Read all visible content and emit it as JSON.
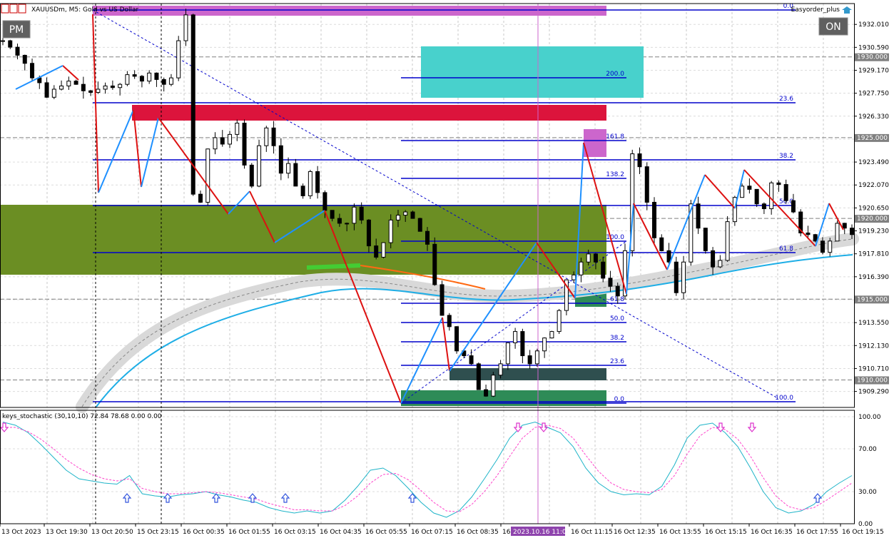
{
  "header": {
    "symbol_text": "XAUUSDm, M5:  Gold vs US Dollar",
    "ea_text": "Easyorder_plus",
    "pm_button": "PM",
    "on_button": "ON"
  },
  "price_axis": {
    "ticks": [
      "1932.010",
      "1930.590",
      "1929.170",
      "1927.750",
      "1926.330",
      "1924.910",
      "1923.490",
      "1922.070",
      "1920.650",
      "1919.230",
      "1917.810",
      "1916.390",
      "1914.970",
      "1913.550",
      "1912.130",
      "1910.710",
      "1909.290"
    ],
    "badges": [
      "1930.000",
      "1925.000",
      "1920.000",
      "1915.000",
      "1910.000"
    ]
  },
  "indicator": {
    "label": "keys_stochastic (30,10,10) 72.84 78.68 0.00 0.00",
    "ticks": [
      "100.00",
      "70.00",
      "30.00",
      "0.00"
    ]
  },
  "time_axis": {
    "labels": [
      "13 Oct 2023",
      "13 Oct 19:30",
      "13 Oct 20:50",
      "15 Oct 23:15",
      "16 Oct 00:35",
      "16 Oct 01:55",
      "16 Oct 03:15",
      "16 Oct 04:35",
      "16 Oct 05:55",
      "16 Oct 07:15",
      "16 Oct 08:35",
      "16",
      "16 Oct 11:15",
      "16 Oct 12:35",
      "16 Oct 13:55",
      "16 Oct 15:15",
      "16 Oct 16:35",
      "16 Oct 17:55",
      "16 Oct 19:15"
    ],
    "highlight": "2023.10.16 11:00"
  },
  "chart_data": [
    {
      "type": "candlestick",
      "title": "XAUUSDm, M5:  Gold vs US Dollar",
      "y_axis": "price",
      "ylim": [
        1908.3,
        1933.3
      ],
      "grid": true,
      "price_badges": [
        1930.0,
        1925.0,
        1920.0,
        1915.0,
        1910.0
      ],
      "fib_levels_left": [
        "0.0",
        "23.6",
        "38.2",
        "50.0",
        "61.8",
        "100.0"
      ],
      "fib_levels_right": [
        "200.0",
        "161.8",
        "138.2",
        "100.0",
        "-61.8",
        "50.0",
        "38.2",
        "23.6",
        "0.0"
      ],
      "zones": [
        {
          "color": "#cc66cc"
        },
        {
          "color": "#48d1cc"
        },
        {
          "color": "#dc143c"
        },
        {
          "color": "#6b8e23"
        },
        {
          "color": "#2e8b57"
        },
        {
          "color": "#2f4f4f"
        }
      ],
      "close_path": [
        1931,
        1930.6,
        1930.1,
        1929.6,
        1928.7,
        1928.4,
        1927.5,
        1928.0,
        1928.2,
        1928.5,
        1928.3,
        1927.9,
        1927.8,
        1928.0,
        1928.2,
        1928.1,
        1928.3,
        1928.9,
        1928.8,
        1928.5,
        1929.0,
        1928.6,
        1928.3,
        1928.7,
        1931.0,
        1932.6,
        1921.5,
        1921.0,
        1924.3,
        1925.0,
        1924.6,
        1925.2,
        1925.9,
        1923.3,
        1922.0,
        1924.5,
        1925.6,
        1924.5,
        1922.8,
        1923.4,
        1922.0,
        1921.4,
        1922.9,
        1921.6,
        1920.5,
        1920.0,
        1919.7,
        1919.7,
        1920.7,
        1919.9,
        1918.3,
        1917.6,
        1918.5,
        1919.9,
        1920.2,
        1920.4,
        1920.0,
        1919.2,
        1918.4,
        1915.9,
        1914.0,
        1913.3,
        1911.8,
        1911.5,
        1911.0,
        1909.4,
        1909.0,
        1910.3,
        1911.0,
        1912.3,
        1913.0,
        1911.5,
        1911.0,
        1911.8,
        1912.6,
        1913.0,
        1914.3,
        1916.2,
        1916.5,
        1917.3,
        1917.8,
        1917.3,
        1916.3,
        1915.8,
        1915.2,
        1918.0,
        1924.0,
        1923.2,
        1921.0,
        1918.8,
        1918.0,
        1917.3,
        1915.4,
        1917.3,
        1920.9,
        1919.4,
        1918.0,
        1917.0,
        1917.4,
        1919.8,
        1921.3,
        1922.0,
        1921.8,
        1920.9,
        1920.6,
        1922.2,
        1922.1,
        1921.1,
        1920.4,
        1919.1,
        1919.0,
        1918.6,
        1917.9,
        1918.6,
        1919.7,
        1919.4,
        1919.0
      ]
    },
    {
      "type": "line",
      "title": "keys_stochastic (30,10,10) 72.84 78.68 0.00 0.00",
      "ylim": [
        0,
        100
      ],
      "y_ticks": [
        100,
        70,
        30,
        0
      ],
      "series": [
        {
          "values": [
            95,
            92,
            85,
            74,
            62,
            50,
            42,
            40,
            38,
            37,
            45,
            28,
            26,
            25,
            27,
            28,
            30,
            27,
            25,
            22,
            20,
            15,
            12,
            10,
            12,
            10,
            12,
            22,
            35,
            50,
            52,
            45,
            33,
            20,
            10,
            6,
            12,
            25,
            42,
            60,
            80,
            92,
            95,
            90,
            85,
            72,
            52,
            38,
            30,
            27,
            28,
            27,
            35,
            55,
            80,
            92,
            94,
            85,
            72,
            52,
            30,
            15,
            10,
            12,
            18,
            30,
            38,
            45
          ]
        },
        {
          "values": [
            90,
            90,
            86,
            79,
            70,
            60,
            52,
            46,
            42,
            40,
            42,
            33,
            30,
            28,
            28,
            29,
            30,
            29,
            27,
            25,
            23,
            19,
            16,
            13,
            13,
            12,
            12,
            17,
            26,
            38,
            46,
            47,
            41,
            31,
            20,
            12,
            11,
            18,
            30,
            45,
            63,
            80,
            90,
            92,
            89,
            80,
            64,
            49,
            38,
            32,
            30,
            29,
            32,
            45,
            65,
            82,
            90,
            88,
            79,
            63,
            43,
            26,
            16,
            13,
            15,
            22,
            30,
            38
          ]
        }
      ]
    }
  ]
}
